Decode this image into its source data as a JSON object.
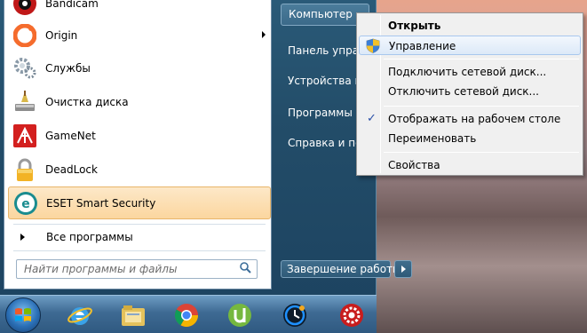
{
  "start_menu": {
    "programs": [
      {
        "label": "Bandicam",
        "icon": "bandicam-icon"
      },
      {
        "label": "Origin",
        "icon": "origin-icon",
        "has_submenu": true
      },
      {
        "label": "Службы",
        "icon": "services-gear-icon"
      },
      {
        "label": "Очистка диска",
        "icon": "disk-cleanup-icon"
      },
      {
        "label": "GameNet",
        "icon": "gamenet-icon"
      },
      {
        "label": "DeadLock",
        "icon": "lock-icon"
      },
      {
        "label": "ESET Smart Security",
        "icon": "eset-icon",
        "highlighted": true
      }
    ],
    "all_programs_label": "Все программы",
    "search_placeholder": "Найти программы и файлы",
    "right_items": [
      {
        "label": "Компьютер",
        "highlighted": true
      },
      {
        "label": "Панель управления"
      },
      {
        "label": "Устройства и принтеры"
      },
      {
        "label": "Программы по умолчанию"
      },
      {
        "label": "Справка и поддержка"
      }
    ],
    "shutdown_label": "Завершение работы"
  },
  "context_menu": {
    "items": [
      {
        "label": "Открыть",
        "bold": true
      },
      {
        "label": "Управление",
        "highlighted": true,
        "icon": "uac-shield-icon"
      },
      {
        "separator": true
      },
      {
        "label": "Подключить сетевой диск..."
      },
      {
        "label": "Отключить сетевой диск..."
      },
      {
        "separator": true
      },
      {
        "label": "Отображать на рабочем столе",
        "checked": true
      },
      {
        "label": "Переименовать"
      },
      {
        "separator": true
      },
      {
        "label": "Свойства"
      }
    ]
  },
  "taskbar": {
    "icons": [
      "start-orb-icon",
      "internet-explorer-icon",
      "file-explorer-icon",
      "chrome-icon",
      "utorrent-icon",
      "clock-app-icon",
      "red-gear-app-icon"
    ]
  },
  "colors": {
    "highlight_orange": "#fbd69f",
    "menu_blue": "#2a5a78",
    "ctx_highlight": "#dce9f8"
  }
}
